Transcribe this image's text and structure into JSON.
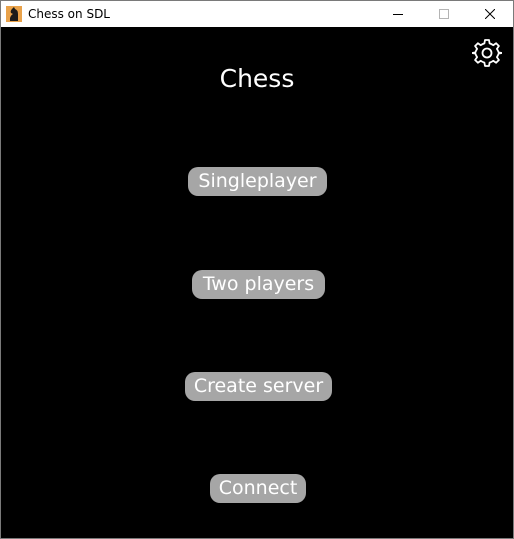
{
  "window": {
    "title": "Chess on SDL",
    "app_icon": "chess-knight-icon",
    "controls": [
      "minimize-icon",
      "maximize-icon",
      "close-icon"
    ]
  },
  "toolbar": {
    "settings_icon": "gear-icon"
  },
  "main": {
    "heading": "Chess",
    "buttons": [
      {
        "label": "Singleplayer"
      },
      {
        "label": "Two players"
      },
      {
        "label": "Create server"
      },
      {
        "label": "Connect"
      }
    ]
  },
  "colors": {
    "background": "#000000",
    "button_fill": "#a6a6a6",
    "text": "#ffffff",
    "titlebar": "#ffffff"
  }
}
